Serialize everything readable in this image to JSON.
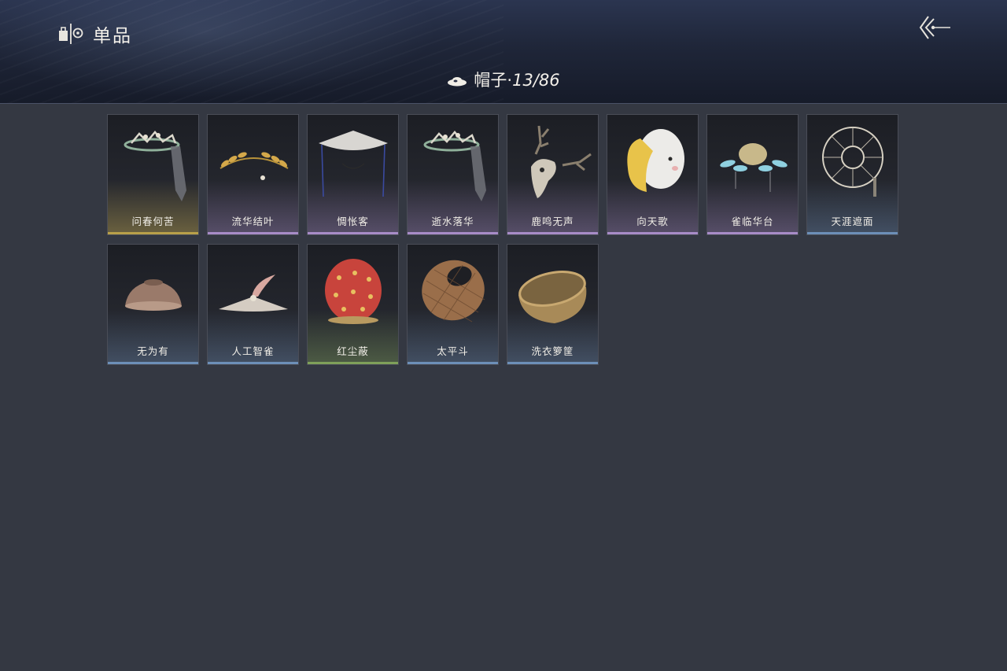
{
  "header": {
    "title": "单品",
    "category_icon": "wardrobe-icon",
    "back_icon": "back-arrow-icon"
  },
  "subheader": {
    "category": "帽子·",
    "count": "13/86",
    "icon": "hat-icon"
  },
  "items": [
    {
      "name": "问春何苦",
      "rarity_color": "#b8a04a",
      "art": "veil-crown"
    },
    {
      "name": "流华结叶",
      "rarity_color": "#a88cc8",
      "art": "laurel-wreath"
    },
    {
      "name": "惆怅客",
      "rarity_color": "#a88cc8",
      "art": "veiled-hat"
    },
    {
      "name": "逝水落华",
      "rarity_color": "#a88cc8",
      "art": "veil-crown"
    },
    {
      "name": "鹿鸣无声",
      "rarity_color": "#a88cc8",
      "art": "deer-skull"
    },
    {
      "name": "向天歌",
      "rarity_color": "#a88cc8",
      "art": "goose-hood"
    },
    {
      "name": "雀临华台",
      "rarity_color": "#a88cc8",
      "art": "blue-headdress"
    },
    {
      "name": "天涯遮面",
      "rarity_color": "#6d8fb8",
      "art": "ring-fan"
    },
    {
      "name": "无为有",
      "rarity_color": "#6d8fb8",
      "art": "clay-bowl"
    },
    {
      "name": "人工智雀",
      "rarity_color": "#6d8fb8",
      "art": "bird-hat"
    },
    {
      "name": "红尘蔽",
      "rarity_color": "#7fa05a",
      "art": "red-hood"
    },
    {
      "name": "太平斗",
      "rarity_color": "#6d8fb8",
      "art": "wicker-basket"
    },
    {
      "name": "洗衣箩筐",
      "rarity_color": "#6d8fb8",
      "art": "laundry-basket"
    }
  ]
}
